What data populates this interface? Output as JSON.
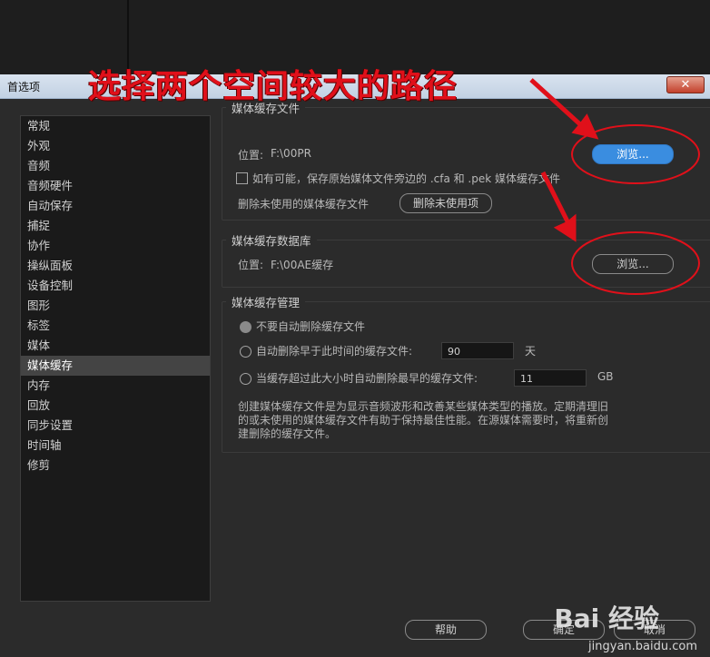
{
  "window": {
    "title": "首选项",
    "close_glyph": "✕"
  },
  "annotation": {
    "text": "选择两个空间较大的路径",
    "color": "#e0101a"
  },
  "sidebar": {
    "items": [
      {
        "label": "常规"
      },
      {
        "label": "外观"
      },
      {
        "label": "音频"
      },
      {
        "label": "音频硬件"
      },
      {
        "label": "自动保存"
      },
      {
        "label": "捕捉"
      },
      {
        "label": "协作"
      },
      {
        "label": "操纵面板"
      },
      {
        "label": "设备控制"
      },
      {
        "label": "图形"
      },
      {
        "label": "标签"
      },
      {
        "label": "媒体"
      },
      {
        "label": "媒体缓存",
        "selected": true
      },
      {
        "label": "内存"
      },
      {
        "label": "回放"
      },
      {
        "label": "同步设置"
      },
      {
        "label": "时间轴"
      },
      {
        "label": "修剪"
      }
    ]
  },
  "media_cache_files": {
    "heading": "媒体缓存文件",
    "location_label": "位置:",
    "location_value": "F:\\00PR",
    "browse_label": "浏览...",
    "checkbox_label": "如有可能，保存原始媒体文件旁边的 .cfa 和 .pek 媒体缓存文件",
    "checked": false,
    "delete_unused_label": "删除未使用的媒体缓存文件",
    "delete_unused_button": "删除未使用项"
  },
  "media_cache_db": {
    "heading": "媒体缓存数据库",
    "location_label": "位置:",
    "location_value": "F:\\00AE缓存",
    "browse_label": "浏览..."
  },
  "media_cache_mgmt": {
    "heading": "媒体缓存管理",
    "option1": "不要自动删除缓存文件",
    "option2": "自动删除早于此时间的缓存文件:",
    "option2_value": "90",
    "option2_unit": "天",
    "option3": "当缓存超过此大小时自动删除最早的缓存文件:",
    "option3_value": "11",
    "option3_unit": "GB",
    "description": "创建媒体缓存文件是为显示音频波形和改善某些媒体类型的播放。定期清理旧的或未使用的媒体缓存文件有助于保持最佳性能。在源媒体需要时，将重新创建删除的缓存文件。"
  },
  "footer": {
    "help": "帮助",
    "ok": "确定",
    "cancel": "取消"
  },
  "watermark": {
    "main": "Bai 经验",
    "sub": "jingyan.baidu.com"
  }
}
